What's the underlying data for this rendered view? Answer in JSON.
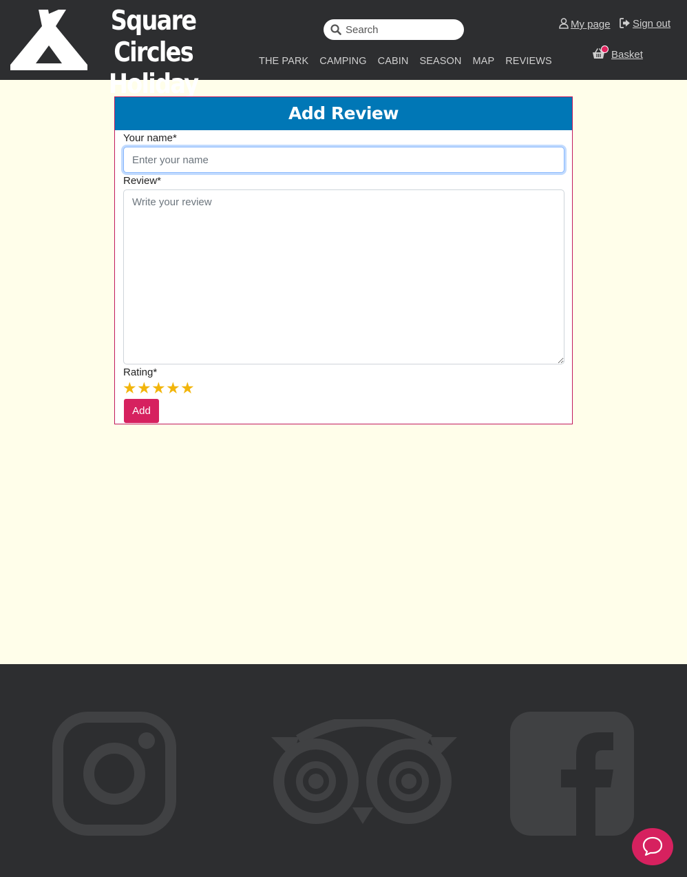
{
  "header": {
    "brand_line1": "Square Circles",
    "brand_line2": "Holiday Park",
    "search_placeholder": "Search",
    "nav": [
      "THE PARK",
      "CAMPING",
      "CABIN",
      "SEASON",
      "MAP",
      "REVIEWS"
    ],
    "my_page": "My page",
    "sign_out": "Sign out",
    "basket": "Basket"
  },
  "form": {
    "title": "Add Review",
    "name_label": "Your name*",
    "name_placeholder": "Enter your name",
    "review_label": "Review*",
    "review_placeholder": "Write your review",
    "rating_label": "Rating*",
    "rating_max": 5,
    "stars": [
      "★",
      "★",
      "★",
      "★",
      "★"
    ],
    "submit_label": "Add"
  },
  "footer": {
    "social": [
      "instagram-icon",
      "tripadvisor-icon",
      "facebook-icon"
    ]
  },
  "colors": {
    "header_bg": "#2d2e30",
    "page_bg": "#fffeea",
    "card_header": "#0077b6",
    "accent": "#d6215f",
    "star": "#f2b50b"
  }
}
